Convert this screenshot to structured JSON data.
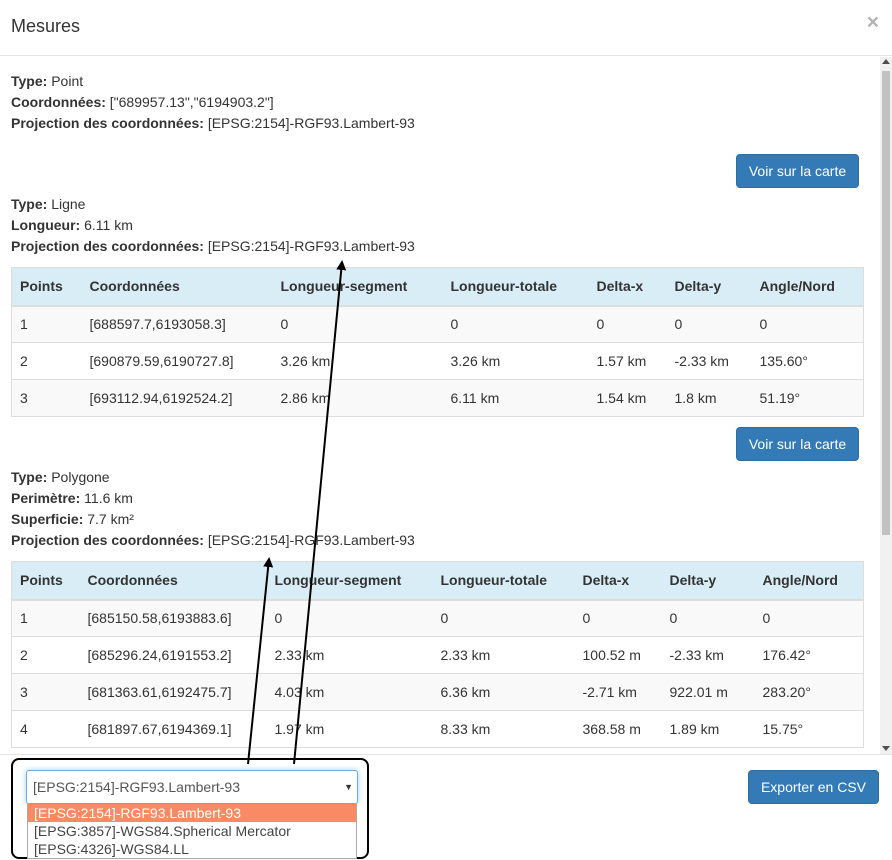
{
  "modal": {
    "title": "Mesures",
    "close_symbol": "×"
  },
  "labels": {
    "type": "Type:",
    "coords": "Coordonnées:",
    "projection": "Projection des coordonnées:",
    "length": "Longueur:",
    "perimeter": "Perimètre:",
    "area": "Superficie:"
  },
  "point": {
    "type": "Point",
    "coords": "[\"689957.13\",\"6194903.2\"]",
    "projection": "[EPSG:2154]-RGF93.Lambert-93",
    "button": "Voir sur la carte"
  },
  "line": {
    "type": "Ligne",
    "length": "6.11 km",
    "projection": "[EPSG:2154]-RGF93.Lambert-93",
    "button": "Voir sur la carte",
    "headers": [
      "Points",
      "Coordonnées",
      "Longueur-segment",
      "Longueur-totale",
      "Delta-x",
      "Delta-y",
      "Angle/Nord"
    ],
    "rows": [
      [
        "1",
        "[688597.7,6193058.3]",
        "0",
        "0",
        "0",
        "0",
        "0"
      ],
      [
        "2",
        "[690879.59,6190727.8]",
        "3.26 km",
        "3.26 km",
        "1.57 km",
        "-2.33 km",
        "135.60°"
      ],
      [
        "3",
        "[693112.94,6192524.2]",
        "2.86 km",
        "6.11 km",
        "1.54 km",
        "1.8 km",
        "51.19°"
      ]
    ]
  },
  "polygon": {
    "type": "Polygone",
    "perimeter": "11.6 km",
    "area": "7.7 km²",
    "projection": "[EPSG:2154]-RGF93.Lambert-93",
    "headers": [
      "Points",
      "Coordonnées",
      "Longueur-segment",
      "Longueur-totale",
      "Delta-x",
      "Delta-y",
      "Angle/Nord"
    ],
    "rows": [
      [
        "1",
        "[685150.58,6193883.6]",
        "0",
        "0",
        "0",
        "0",
        "0"
      ],
      [
        "2",
        "[685296.24,6191553.2]",
        "2.33 km",
        "2.33 km",
        "100.52 m",
        "-2.33 km",
        "176.42°"
      ],
      [
        "3",
        "[681363.61,6192475.7]",
        "4.03 km",
        "6.36 km",
        "-2.71 km",
        "922.01 m",
        "283.20°"
      ],
      [
        "4",
        "[681897.67,6194369.1]",
        "1.97 km",
        "8.33 km",
        "368.58 m",
        "1.89 km",
        "15.75°"
      ]
    ]
  },
  "footer": {
    "select_value": "[EPSG:2154]-RGF93.Lambert-93",
    "options": [
      "[EPSG:2154]-RGF93.Lambert-93",
      "[EPSG:3857]-WGS84.Spherical Mercator",
      "[EPSG:4326]-WGS84.LL"
    ],
    "export_button": "Exporter en CSV"
  },
  "colors": {
    "primary": "#337ab7",
    "table_header": "#d9edf7",
    "selected_option": "#f98a63"
  }
}
